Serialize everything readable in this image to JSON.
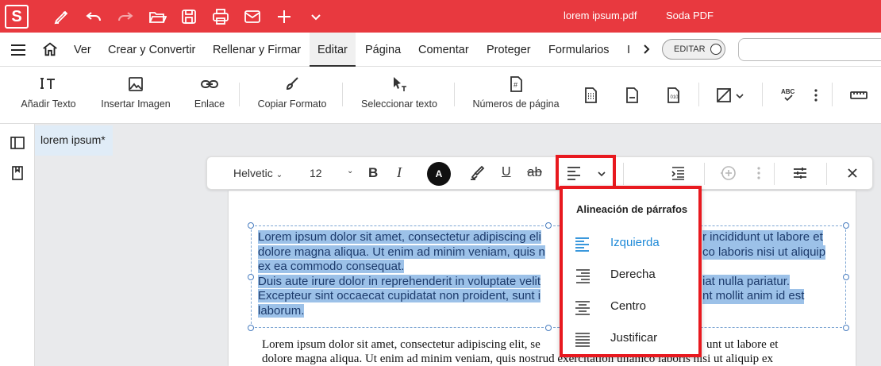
{
  "titlebar": {
    "logo": "S",
    "document_title": "lorem ipsum.pdf",
    "app_title": "Soda PDF",
    "icons": [
      "sign-icon",
      "undo-icon",
      "redo-icon",
      "open-folder-icon",
      "save-icon",
      "print-icon",
      "mail-icon",
      "plus-icon",
      "chevron-down-icon"
    ]
  },
  "menubar": {
    "items": [
      "Ver",
      "Crear y Convertir",
      "Rellenar y Firmar",
      "Editar",
      "Página",
      "Comentar",
      "Proteger",
      "Formularios",
      "I"
    ],
    "active": "Editar",
    "edit_toggle_label": "EDITAR",
    "search_placeholder": ""
  },
  "ribbon": {
    "add_text": "Añadir Texto",
    "insert_image": "Insertar Imagen",
    "link": "Enlace",
    "copy_format": "Copiar Formato",
    "select_text": "Seleccionar texto",
    "page_numbers": "Números de página"
  },
  "document_tab": {
    "name": "lorem ipsum",
    "modified_marker": "*"
  },
  "format_toolbar": {
    "font_family": "Helvetic",
    "font_size": "12",
    "text_color_label": "A"
  },
  "alignment_dropdown": {
    "title": "Alineación de párrafos",
    "options": [
      "Izquierda",
      "Derecha",
      "Centro",
      "Justificar"
    ],
    "selected": "Izquierda"
  },
  "page": {
    "selected_paragraphs": [
      "Lorem ipsum dolor sit amet, consectetur adipiscing eli",
      "r incididunt ut labore et",
      "dolore magna aliqua. Ut enim ad minim veniam, quis n",
      "co laboris nisi ut aliquip",
      "ex ea commodo consequat.",
      "Duis aute irure dolor in reprehenderit in voluptate velit",
      "iat nulla pariatur.",
      "Excepteur sint occaecat cupidatat non proident, sunt i",
      "nt mollit anim id est",
      "laborum."
    ],
    "body_line_1": "Lorem ipsum dolor sit amet, consectetur adipiscing elit, se",
    "body_line_1b": "unt ut labore et",
    "body_line_2": "dolore magna aliqua. Ut enim ad minim veniam, quis nostrud exercitation ullamco laboris nisi ut aliquip ex"
  },
  "colors": {
    "titlebar_bg": "#e8393f",
    "highlight_border": "#e8191f",
    "selection_bg": "#9cc1e8",
    "active_option": "#1f8ad8"
  }
}
